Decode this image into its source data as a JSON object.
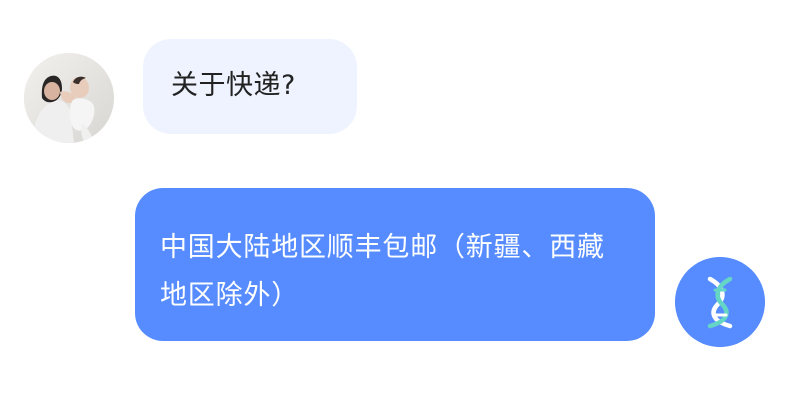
{
  "conversation": {
    "messages": [
      {
        "role": "user",
        "text": "关于快递?"
      },
      {
        "role": "assistant",
        "text": "中国大陆地区顺丰包邮（新疆、西藏地区除外）"
      }
    ],
    "avatars": {
      "user": "photo-avatar",
      "assistant": "dna-helix-icon"
    },
    "colors": {
      "user_bubble": "#eef3ff",
      "assistant_bubble": "#568cff",
      "assistant_avatar": "#568cff",
      "assistant_text": "#ffffff",
      "user_text": "#222222"
    }
  }
}
